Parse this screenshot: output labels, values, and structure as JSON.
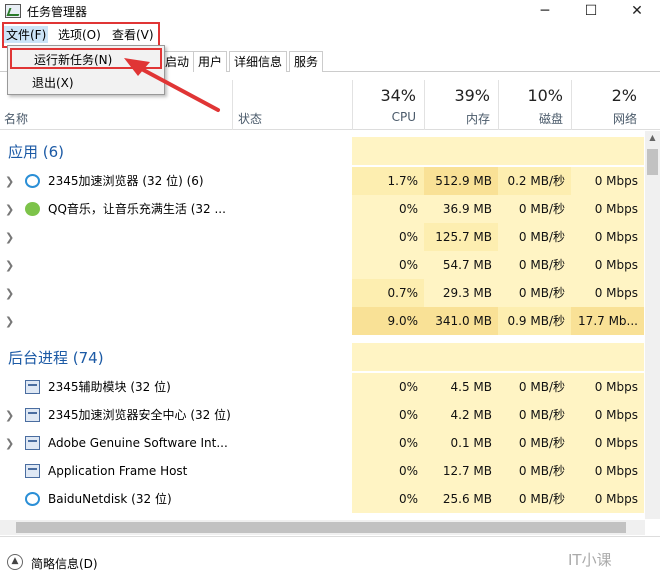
{
  "window": {
    "title": "任务管理器",
    "minimize": "─",
    "maximize": "☐",
    "close": "✕"
  },
  "menu": {
    "file": "文件(F)",
    "options": "选项(O)",
    "view": "查看(V)"
  },
  "dropdown": {
    "run_new_task": "运行新任务(N)",
    "exit": "退出(X)"
  },
  "tabs": [
    "启动",
    "用户",
    "详细信息",
    "服务"
  ],
  "columns": {
    "name": "名称",
    "status": "状态",
    "cpu": {
      "pct": "34%",
      "label": "CPU"
    },
    "memory": {
      "pct": "39%",
      "label": "内存"
    },
    "disk": {
      "pct": "10%",
      "label": "磁盘"
    },
    "network": {
      "pct": "2%",
      "label": "网络"
    }
  },
  "sections": {
    "apps": "应用 (6)",
    "background": "后台进程 (74)"
  },
  "apps": [
    {
      "name": "2345加速浏览器 (32 位) (6)",
      "cpu": "1.7%",
      "mem": "512.9 MB",
      "disk": "0.2 MB/秒",
      "net": "0 Mbps"
    },
    {
      "name": "QQ音乐，让音乐充满生活 (32 ...",
      "cpu": "0%",
      "mem": "36.9 MB",
      "disk": "0 MB/秒",
      "net": "0 Mbps"
    },
    {
      "name": "",
      "cpu": "0%",
      "mem": "125.7 MB",
      "disk": "0 MB/秒",
      "net": "0 Mbps"
    },
    {
      "name": "",
      "cpu": "0%",
      "mem": "54.7 MB",
      "disk": "0 MB/秒",
      "net": "0 Mbps"
    },
    {
      "name": "",
      "cpu": "0.7%",
      "mem": "29.3 MB",
      "disk": "0 MB/秒",
      "net": "0 Mbps"
    },
    {
      "name": "",
      "cpu": "9.0%",
      "mem": "341.0 MB",
      "disk": "0.9 MB/秒",
      "net": "17.7 Mb..."
    }
  ],
  "background": [
    {
      "name": "2345辅助模块 (32 位)",
      "cpu": "0%",
      "mem": "4.5 MB",
      "disk": "0 MB/秒",
      "net": "0 Mbps"
    },
    {
      "name": "2345加速浏览器安全中心 (32 位)",
      "cpu": "0%",
      "mem": "4.2 MB",
      "disk": "0 MB/秒",
      "net": "0 Mbps"
    },
    {
      "name": "Adobe Genuine Software Int...",
      "cpu": "0%",
      "mem": "0.1 MB",
      "disk": "0 MB/秒",
      "net": "0 Mbps"
    },
    {
      "name": "Application Frame Host",
      "cpu": "0%",
      "mem": "12.7 MB",
      "disk": "0 MB/秒",
      "net": "0 Mbps"
    },
    {
      "name": "BaiduNetdisk (32 位)",
      "cpu": "0%",
      "mem": "25.6 MB",
      "disk": "0 MB/秒",
      "net": "0 Mbps"
    }
  ],
  "footer": {
    "brief": "简略信息(D)",
    "watermark": "IT小课"
  },
  "colors": {
    "highlight_red": "#e03535",
    "section_blue": "#1c5aa5",
    "heat_light": "#fff4c4",
    "heat_mid": "#fdeeb0",
    "heat_strong": "#f9e196"
  }
}
